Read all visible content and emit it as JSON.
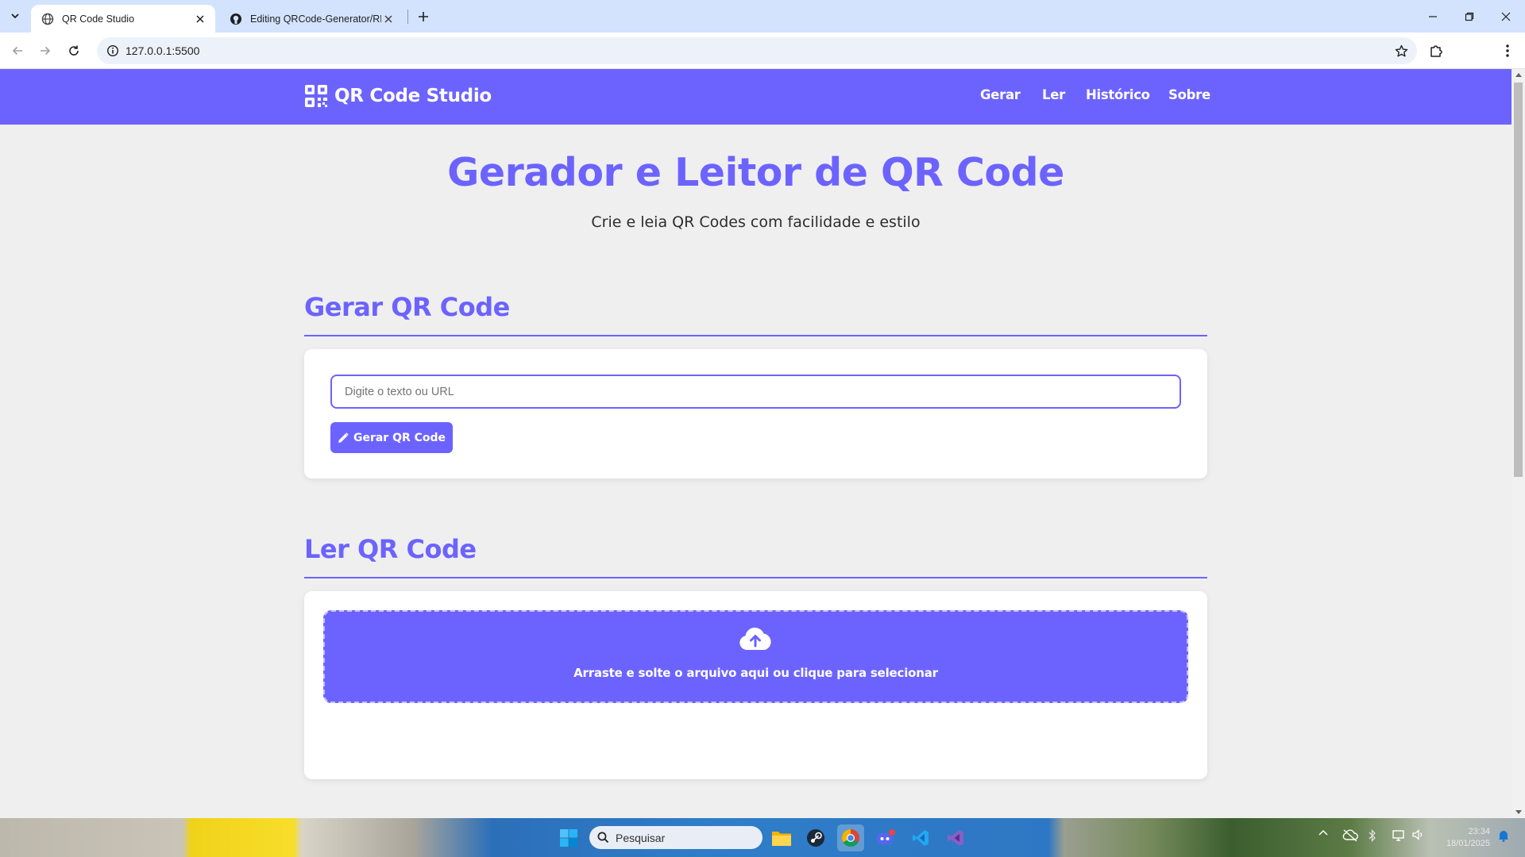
{
  "browser": {
    "tabs": [
      {
        "title": "QR Code Studio",
        "active": true,
        "favicon": "globe-icon"
      },
      {
        "title": "Editing QRCode-Generator/README.md",
        "active": false,
        "favicon": "github-icon"
      }
    ],
    "url": "127.0.0.1:5500"
  },
  "site": {
    "brand": "QR Code Studio",
    "nav": [
      "Gerar",
      "Ler",
      "Histórico",
      "Sobre"
    ],
    "accent_color": "#6c63ff"
  },
  "hero": {
    "title": "Gerador e Leitor de QR Code",
    "subtitle": "Crie e leia QR Codes com facilidade e estilo"
  },
  "generate": {
    "heading": "Gerar QR Code",
    "input_placeholder": "Digite o texto ou URL",
    "input_value": "",
    "button_label": "Gerar QR Code",
    "button_icon": "pencil-icon"
  },
  "read": {
    "heading": "Ler QR Code",
    "dropzone_text": "Arraste e solte o arquivo aqui ou clique para selecionar",
    "dropzone_icon": "cloud-upload-icon"
  },
  "taskbar": {
    "search_placeholder": "Pesquisar",
    "clock_time": "23:34",
    "clock_date": "18/01/2025"
  }
}
